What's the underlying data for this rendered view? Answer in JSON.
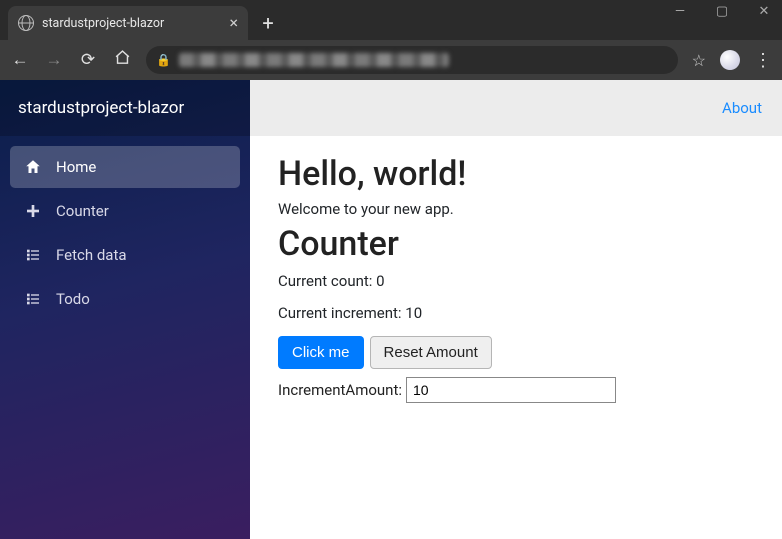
{
  "browser": {
    "tab_title": "stardustproject-blazor"
  },
  "app": {
    "brand": "stardustproject-blazor",
    "about": "About",
    "nav": [
      {
        "label": "Home",
        "active": true
      },
      {
        "label": "Counter",
        "active": false
      },
      {
        "label": "Fetch data",
        "active": false
      },
      {
        "label": "Todo",
        "active": false
      }
    ]
  },
  "page": {
    "heading": "Hello, world!",
    "welcome": "Welcome to your new app.",
    "subheading": "Counter",
    "count_label": "Current count:",
    "count_value": "0",
    "increment_label": "Current increment:",
    "increment_value": "10",
    "button_click": "Click me",
    "button_reset": "Reset Amount",
    "input_label": "IncrementAmount:",
    "input_value": "10"
  }
}
